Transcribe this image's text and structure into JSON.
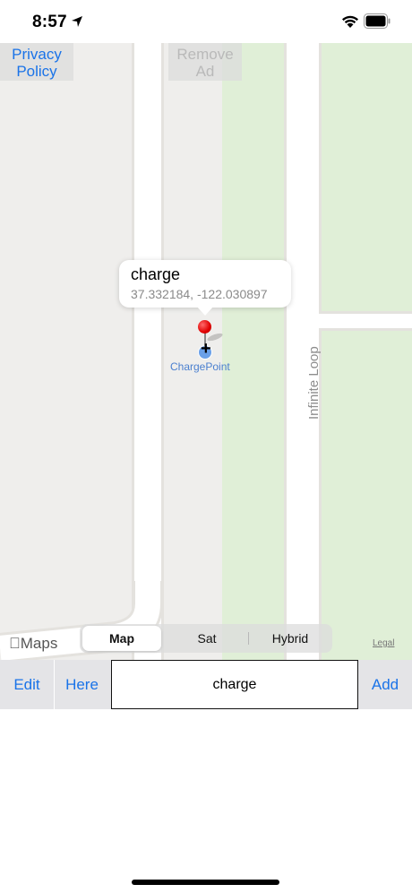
{
  "status_bar": {
    "time": "8:57"
  },
  "map": {
    "privacy_label": "Privacy Policy",
    "remove_ad_label": "Remove Ad",
    "callout": {
      "title": "charge",
      "coords": "37.332184, -122.030897"
    },
    "poi_label": "ChargePoint",
    "street_label": "Infinite Loop",
    "maps_logo": "Maps",
    "legal_label": "Legal",
    "map_type": {
      "options": [
        "Map",
        "Sat",
        "Hybrid"
      ],
      "selected": "Map"
    }
  },
  "toolbar": {
    "edit_label": "Edit",
    "here_label": "Here",
    "search_value": "charge",
    "add_label": "Add"
  },
  "colors": {
    "accent": "#1a73e8",
    "park": "#e0efd7",
    "map_bg": "#efeeec",
    "pin": "#e00000"
  }
}
